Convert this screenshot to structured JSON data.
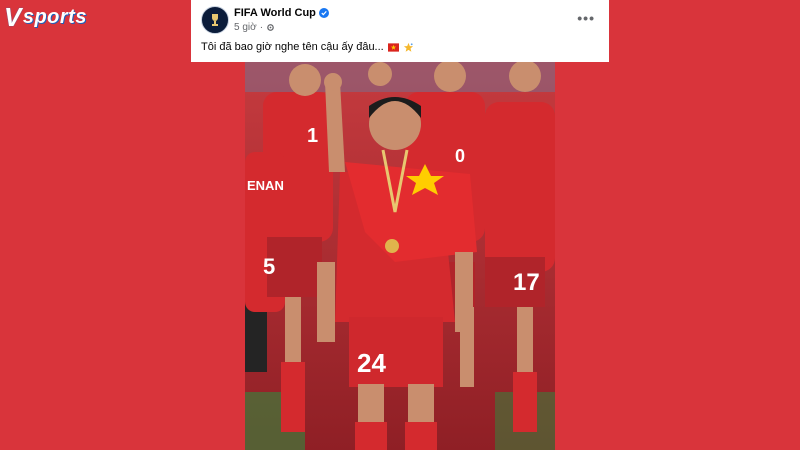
{
  "brand": {
    "v": "V",
    "rest": "sports"
  },
  "post": {
    "page_name": "FIFA World Cup",
    "time": "5 giờ",
    "caption": "Tôi đã bao giờ nghe tên cậu ấy đâu...",
    "more_icon": "more-options-icon",
    "emojis": [
      "vietnam-flag-emoji",
      "star-emoji"
    ]
  },
  "photo": {
    "jersey_numbers": [
      "24",
      "17",
      "5",
      "1",
      "0"
    ],
    "shirt_text": "ENAN"
  },
  "colors": {
    "background": "#d9343b",
    "post_bg": "#ffffff",
    "jersey": "#d42a2e",
    "verified": "#1877f2"
  }
}
